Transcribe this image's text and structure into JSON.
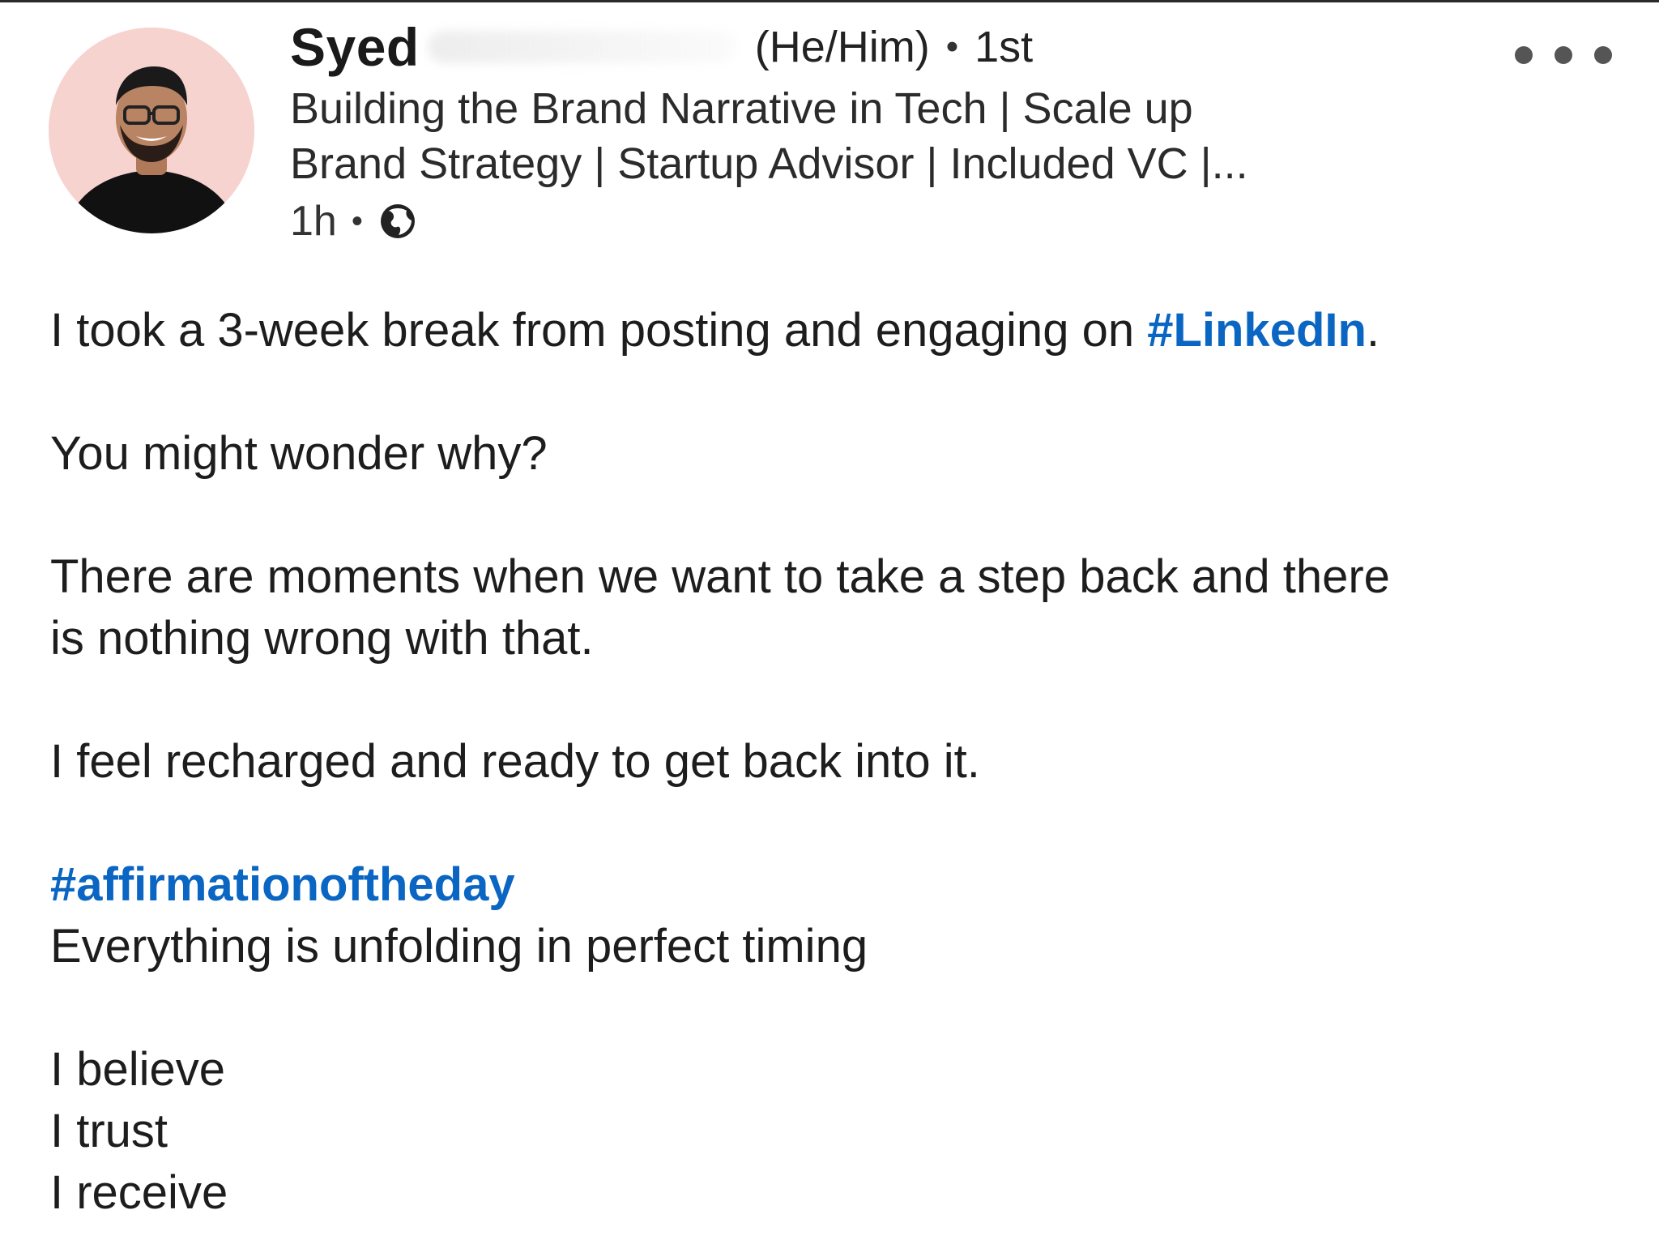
{
  "author": {
    "name": "Syed",
    "pronouns": "(He/Him)",
    "separator": "•",
    "connection": "1st",
    "headline_line1": "Building the Brand Narrative in Tech | Scale up",
    "headline_line2": "Brand Strategy | Startup Advisor | Included VC |...",
    "time": "1h",
    "visibility_icon": "globe-icon",
    "avatar_bg": "#f7d3d0"
  },
  "menu": {
    "icon": "more-options-icon"
  },
  "post": {
    "line1_text": "I took a 3-week break from posting and engaging on ",
    "line1_hashtag": "#LinkedIn",
    "line1_end": ".",
    "line2": "You might wonder why?",
    "line3": "There are moments when we want to take a step back and there",
    "line4": "is nothing wrong with that.",
    "line5": "I feel recharged and ready to get back into it.",
    "hashtag2": "#affirmationoftheday",
    "line6": "Everything is unfolding in perfect timing",
    "line7": "I believe",
    "line8": "I trust",
    "line9": "I receive"
  },
  "colors": {
    "hashtag": "#0a66c2",
    "text": "#1d1d1d"
  }
}
